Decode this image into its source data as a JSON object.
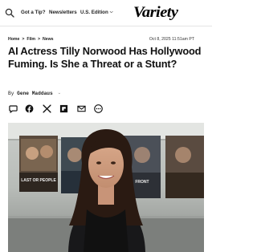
{
  "header": {
    "nav": {
      "tip": "Got a Tip?",
      "newsletters": "Newsletters",
      "edition": "U.S. Edition"
    },
    "logo": "Variety"
  },
  "article": {
    "breadcrumb": [
      "Home",
      "Film",
      "News"
    ],
    "breadcrumb_separator": ">",
    "timestamp": "Oct 8, 2025 11:51am PT",
    "headline": "AI Actress Tilly Norwood Has Hollywood Fuming. Is She a Threat or a Stunt?",
    "byline_prefix": "By",
    "author": "Gene Maddaus"
  },
  "share_icons": [
    "comment-icon",
    "facebook-icon",
    "x-icon",
    "flipboard-icon",
    "email-icon",
    "more-icon"
  ],
  "hero": {
    "poster_text_left": "LAST OR PEOPLE",
    "poster_text_right": "FRONT"
  },
  "colors": {
    "text": "#111111",
    "divider": "#e4e4e4",
    "accent": "#000000"
  }
}
